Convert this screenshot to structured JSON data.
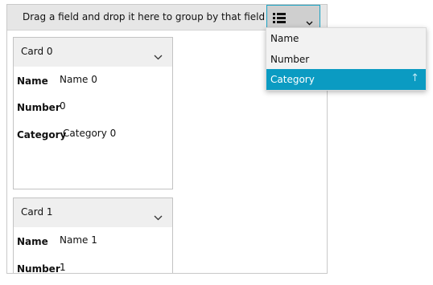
{
  "group_panel": {
    "hint": "Drag a field and drop it here to group by that field",
    "sort_button_icons": [
      "list-icon",
      "chevron-down-icon"
    ]
  },
  "cards": [
    {
      "title": "Card 0",
      "fields": [
        {
          "label": "Name",
          "value": "Name 0"
        },
        {
          "label": "Number",
          "value": "0"
        },
        {
          "label": "Category",
          "value": "Category 0"
        }
      ]
    },
    {
      "title": "Card 1",
      "fields": [
        {
          "label": "Name",
          "value": "Name 1"
        },
        {
          "label": "Number",
          "value": "1"
        }
      ]
    }
  ],
  "sort_menu": {
    "items": [
      {
        "label": "Name",
        "selected": false
      },
      {
        "label": "Number",
        "selected": false
      },
      {
        "label": "Category",
        "selected": true,
        "icon": "arrow-up-icon"
      }
    ]
  },
  "colors": {
    "accent": "#0b9bc2",
    "button_border": "#1aa3c4",
    "group_bar": "#e6e6e6",
    "card_header": "#efefef"
  }
}
